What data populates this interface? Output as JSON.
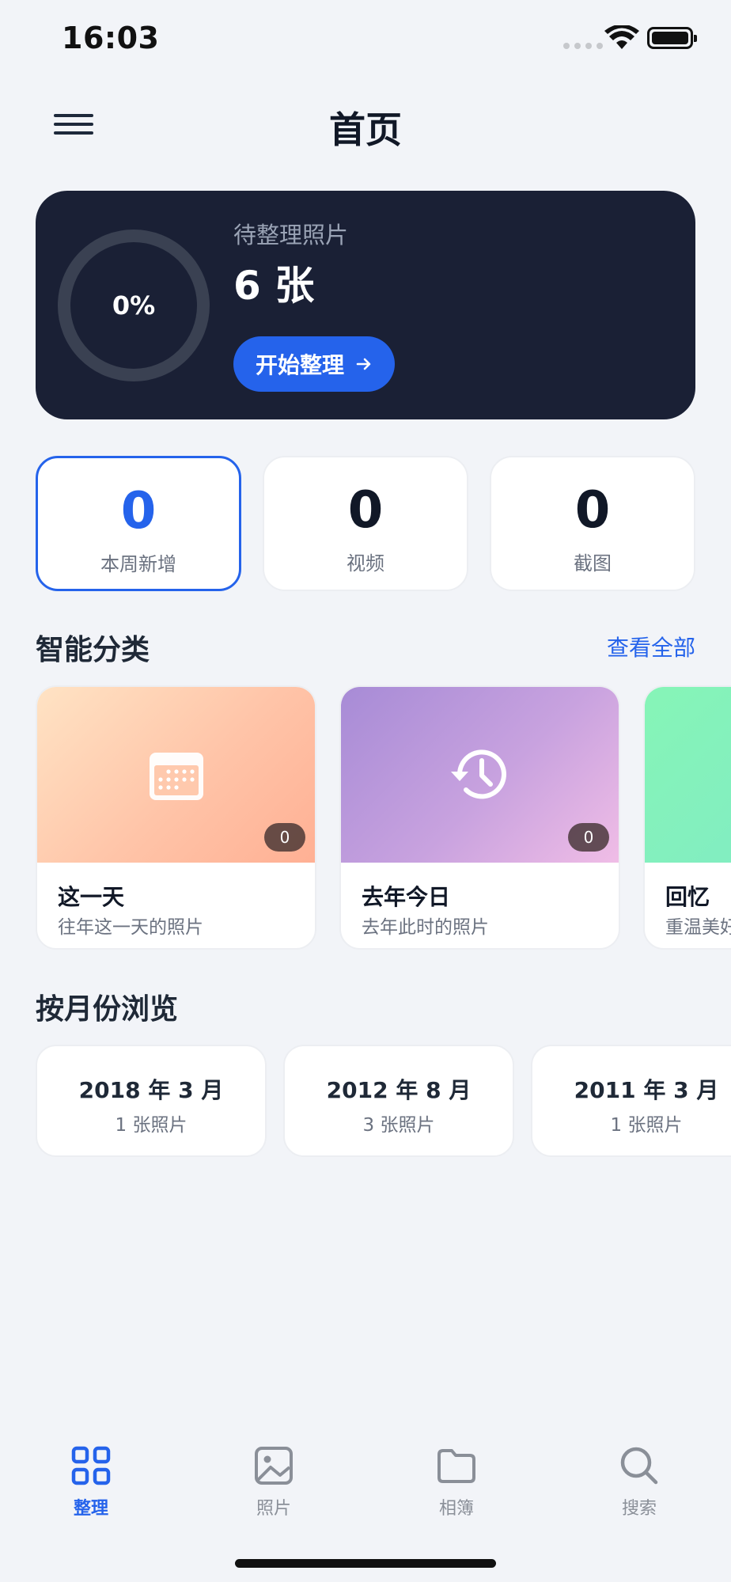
{
  "status_bar": {
    "time": "16:03"
  },
  "header": {
    "title": "首页",
    "menu_icon": "hamburger-menu-icon"
  },
  "hero": {
    "progress_value": 0,
    "progress_label": "0%",
    "subtitle": "待整理照片",
    "count": "6 张",
    "button_label": "开始整理",
    "button_icon": "arrow-right-icon",
    "accent_color": "#2563eb",
    "background_color": "#1a2035"
  },
  "stats": [
    {
      "value": "0",
      "label": "本周新增",
      "active": true
    },
    {
      "value": "0",
      "label": "视频",
      "active": false
    },
    {
      "value": "0",
      "label": "截图",
      "active": false
    }
  ],
  "smart_section": {
    "title": "智能分类",
    "view_all": "查看全部",
    "cards": [
      {
        "title": "这一天",
        "subtitle": "往年这一天的照片",
        "badge": "0",
        "icon": "calendar-icon"
      },
      {
        "title": "去年今日",
        "subtitle": "去年此时的照片",
        "badge": "0",
        "icon": "history-clock-icon"
      },
      {
        "title": "回忆",
        "subtitle": "重温美好"
      }
    ]
  },
  "month_section": {
    "title": "按月份浏览",
    "months": [
      {
        "title": "2018 年 3 月",
        "count": "1 张照片"
      },
      {
        "title": "2012 年 8 月",
        "count": "3 张照片"
      },
      {
        "title": "2011 年 3 月",
        "count": "1 张照片"
      }
    ]
  },
  "tab_bar": {
    "tabs": [
      {
        "label": "整理",
        "icon": "grid-icon",
        "active": true
      },
      {
        "label": "照片",
        "icon": "image-icon",
        "active": false
      },
      {
        "label": "相簿",
        "icon": "folder-icon",
        "active": false
      },
      {
        "label": "搜索",
        "icon": "search-icon",
        "active": false
      }
    ],
    "active_color": "#2563eb",
    "inactive_color": "#8a8f98"
  }
}
